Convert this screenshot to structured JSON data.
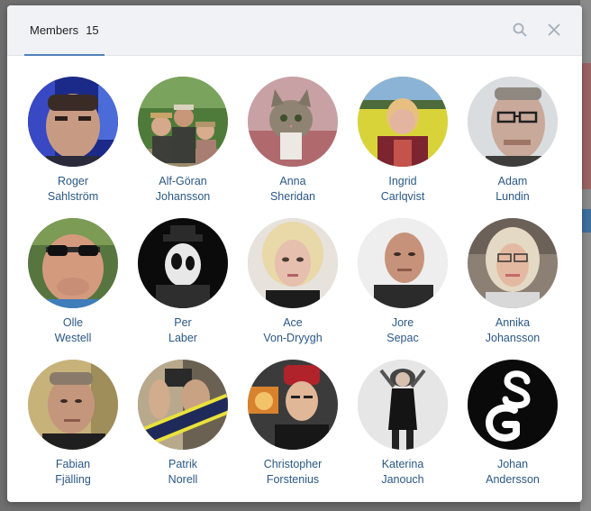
{
  "modal": {
    "tab_label": "Members",
    "tab_count": "15"
  },
  "icons": {
    "search": "search-icon",
    "close": "close-icon"
  },
  "colors": {
    "accent": "#5181b8",
    "link": "#2a5885",
    "header_bg": "#f0f2f5"
  },
  "members": [
    {
      "first": "Roger",
      "last": "Sahlström"
    },
    {
      "first": "Alf-Göran",
      "last": "Johansson"
    },
    {
      "first": "Anna",
      "last": "Sheridan"
    },
    {
      "first": "Ingrid",
      "last": "Carlqvist"
    },
    {
      "first": "Adam",
      "last": "Lundin"
    },
    {
      "first": "Olle",
      "last": "Westell"
    },
    {
      "first": "Per",
      "last": "Laber"
    },
    {
      "first": "Ace",
      "last": "Von-Dryygh"
    },
    {
      "first": "Jore",
      "last": "Sepac"
    },
    {
      "first": "Annika",
      "last": "Johansson"
    },
    {
      "first": "Fabian",
      "last": "Fjälling"
    },
    {
      "first": "Patrik",
      "last": "Norell"
    },
    {
      "first": "Christopher",
      "last": "Forstenius"
    },
    {
      "first": "Katerina",
      "last": "Janouch"
    },
    {
      "first": "Johan",
      "last": "Andersson"
    }
  ]
}
